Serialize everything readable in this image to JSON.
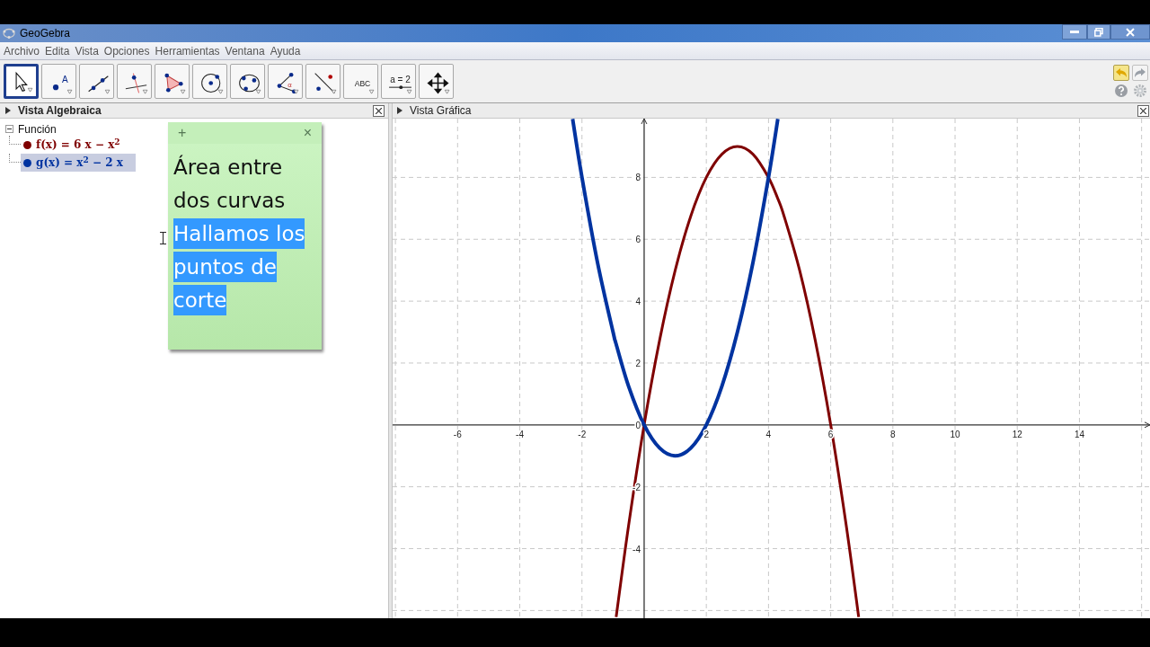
{
  "window": {
    "title": "GeoGebra"
  },
  "menu": [
    "Archivo",
    "Edita",
    "Vista",
    "Opciones",
    "Herramientas",
    "Ventana",
    "Ayuda"
  ],
  "toolbar": [
    {
      "kind": "pointer",
      "selected": true
    },
    {
      "kind": "point",
      "label": "A",
      "selected": false
    },
    {
      "kind": "line",
      "selected": false
    },
    {
      "kind": "perpendicular",
      "selected": false
    },
    {
      "kind": "polygon",
      "selected": false
    },
    {
      "kind": "circle",
      "selected": false
    },
    {
      "kind": "conic",
      "selected": false
    },
    {
      "kind": "angle",
      "label": "α",
      "selected": false
    },
    {
      "kind": "reflect",
      "selected": false
    },
    {
      "kind": "text",
      "label": "ABC",
      "selected": false
    },
    {
      "kind": "slider",
      "label": "a = 2",
      "selected": false
    },
    {
      "kind": "move",
      "selected": false
    }
  ],
  "algebra_view": {
    "title": "Vista Algebraica",
    "groups": [
      {
        "label": "Función",
        "expanded": true,
        "children": [
          {
            "text": "f(x) = 6 x − x$^{2}$",
            "color": "#7f0000",
            "selected": false
          },
          {
            "text": "g(x) = x$^{2}$ − 2 x",
            "color": "#0033a0",
            "selected": true
          }
        ]
      }
    ]
  },
  "note": {
    "add": "+",
    "close": "×",
    "paragraphs": [
      {
        "text": "Área entre dos curvas",
        "selected": false
      },
      {
        "text": "Hallamos los puntos de corte",
        "selected": true
      }
    ]
  },
  "graphics_view": {
    "title": "Vista Gráfica",
    "chart_data": {
      "type": "line",
      "grid": true,
      "xlim": [
        -8.09,
        16.27
      ],
      "ylim": [
        -6.25,
        9.9
      ],
      "xticks": [
        -6,
        -4,
        -2,
        2,
        4,
        6,
        8,
        10,
        12,
        14
      ],
      "yticks": [
        -4,
        -2,
        0,
        2,
        4,
        6,
        8
      ],
      "x": [
        -2.3,
        -2,
        -1.5,
        -1,
        -0.9,
        -0.5,
        0,
        0.5,
        1,
        1.5,
        2,
        2.5,
        3,
        3.5,
        4,
        4.3,
        4.5,
        5,
        5.5,
        6,
        6.5,
        6.9
      ],
      "series": [
        {
          "color": "#7f0000",
          "values": [
            null,
            null,
            null,
            null,
            -6.21,
            -3.25,
            0,
            2.75,
            5,
            6.75,
            8,
            8.75,
            9,
            8.75,
            8,
            7.31,
            6.75,
            5,
            2.75,
            0,
            -3.25,
            -6.21
          ]
        },
        {
          "color": "#0033a0",
          "values": [
            9.89,
            8,
            5.25,
            3,
            2.61,
            1.25,
            0,
            -0.75,
            -1,
            -0.75,
            0,
            1.25,
            3,
            5.25,
            8,
            9.89,
            null,
            null,
            null,
            null,
            null,
            null
          ]
        }
      ]
    }
  }
}
